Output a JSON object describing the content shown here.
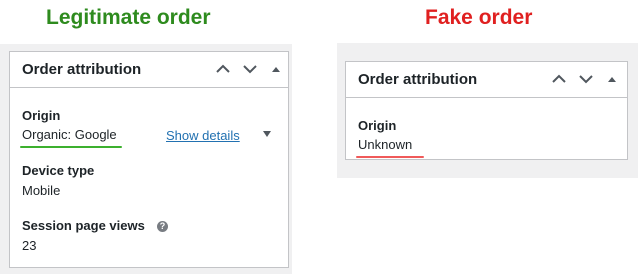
{
  "captions": {
    "legit": {
      "text": "Legitimate order",
      "color": "#2e8b1e"
    },
    "fake": {
      "text": "Fake order",
      "color": "#e02020"
    }
  },
  "legit_panel": {
    "title": "Order attribution",
    "origin_label": "Origin",
    "origin_value": "Organic: Google",
    "show_details": "Show details",
    "device_label": "Device type",
    "device_value": "Mobile",
    "session_label": "Session page views",
    "session_value": "23",
    "help_glyph": "?"
  },
  "fake_panel": {
    "title": "Order attribution",
    "origin_label": "Origin",
    "origin_value": "Unknown"
  },
  "colors": {
    "legit_underline": "#3cb02e",
    "fake_underline": "#f05a5a",
    "link": "#2271b1",
    "panel_border": "#c3c4c7"
  },
  "icons": [
    "chevron-up-icon",
    "chevron-down-icon",
    "toggle-panel-arrow-icon",
    "dropdown-caret-icon",
    "help-icon"
  ]
}
